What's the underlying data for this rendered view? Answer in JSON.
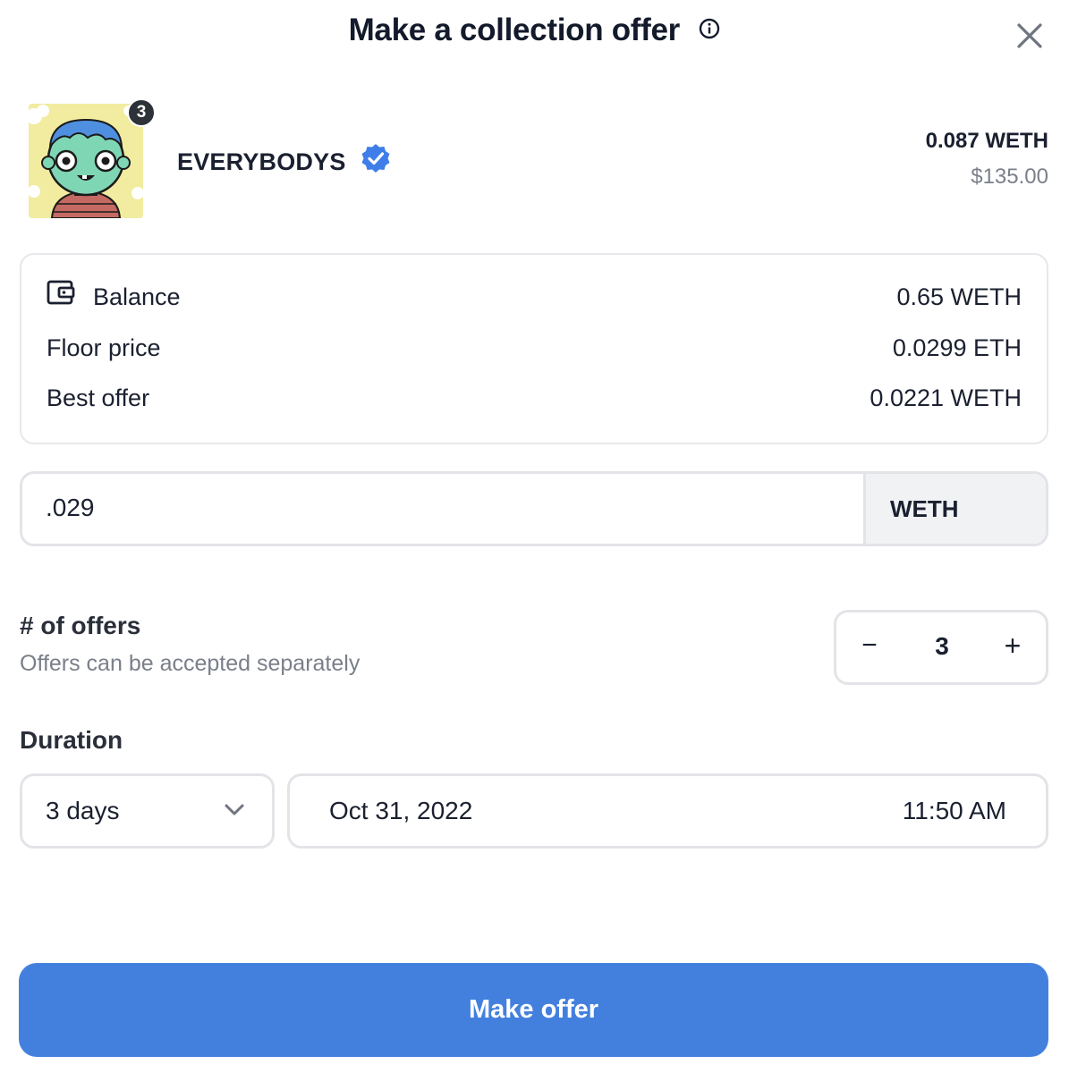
{
  "header": {
    "title": "Make a collection offer",
    "info_icon": "info-circle-icon",
    "close_icon": "close-icon"
  },
  "collection": {
    "name": "EVERYBODYS",
    "badge_count": "3",
    "verified_icon": "verified-check-icon",
    "price": "0.087 WETH",
    "price_usd": "$135.00"
  },
  "summary": {
    "rows": [
      {
        "label": "Balance",
        "value": "0.65 WETH",
        "icon": "wallet-icon"
      },
      {
        "label": "Floor price",
        "value": "0.0299 ETH"
      },
      {
        "label": "Best offer",
        "value": "0.0221 WETH"
      }
    ]
  },
  "offer_input": {
    "value": ".029",
    "currency": "WETH"
  },
  "offers": {
    "label": "# of offers",
    "sublabel": "Offers can be accepted separately",
    "minus": "−",
    "count": "3",
    "plus": "+"
  },
  "duration": {
    "label": "Duration",
    "selected": "3 days",
    "date": "Oct 31, 2022",
    "time": "11:50 AM"
  },
  "submit": {
    "label": "Make offer"
  },
  "colors": {
    "accent": "#4380de",
    "verified": "#3f7ee8",
    "text": "#1b2030",
    "muted": "#7a7f89",
    "border": "#e3e4e8"
  }
}
